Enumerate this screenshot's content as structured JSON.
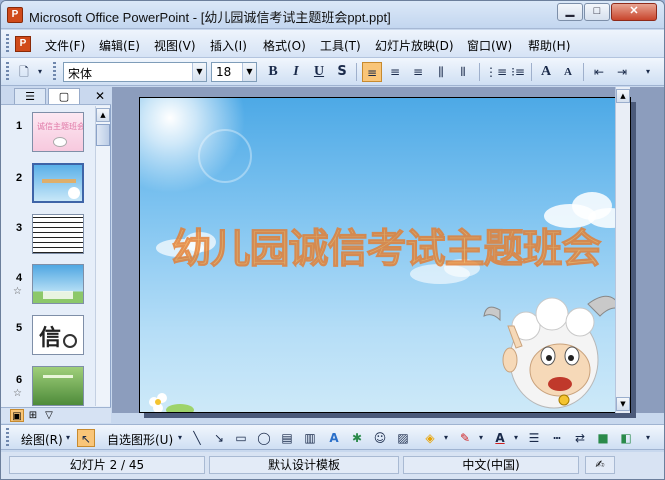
{
  "window": {
    "title": "Microsoft Office PowerPoint - [幼儿园诚信考试主题班会ppt.ppt]",
    "app_icon": "P",
    "buttons": {
      "minimize": "▁",
      "maximize": "□",
      "close": "✕"
    }
  },
  "menu": {
    "items": [
      "文件(F)",
      "编辑(E)",
      "视图(V)",
      "插入(I)",
      "格式(O)",
      "工具(T)",
      "幻灯片放映(D)",
      "窗口(W)",
      "帮助(H)"
    ],
    "doc_icon": "P"
  },
  "toolbar": {
    "font_name": "宋体",
    "font_size": "18",
    "bold": "B",
    "italic": "I",
    "underline": "U",
    "shadow": "S",
    "increase_font": "A",
    "decrease_font": "A"
  },
  "outline_pane": {
    "close": "✕",
    "thumbnails": [
      {
        "number": "1",
        "star": "",
        "caption": "诚信主题班会"
      },
      {
        "number": "2",
        "star": "",
        "caption": ""
      },
      {
        "number": "3",
        "star": "",
        "caption": ""
      },
      {
        "number": "4",
        "star": "☆",
        "caption": ""
      },
      {
        "number": "5",
        "star": "",
        "caption": "信"
      },
      {
        "number": "6",
        "star": "☆",
        "caption": ""
      }
    ]
  },
  "slide": {
    "title": "幼儿园诚信考试主题班会"
  },
  "drawing_toolbar": {
    "draw_label": "绘图(R)",
    "autoshapes_label": "自选图形(U)"
  },
  "status": {
    "slide_info": "幻灯片 2 / 45",
    "template": "默认设计模板",
    "language": "中文(中国)"
  },
  "colors": {
    "slide_title": "#f2a84a",
    "selected_button": "#f9c578",
    "close_button": "#c8452c"
  }
}
